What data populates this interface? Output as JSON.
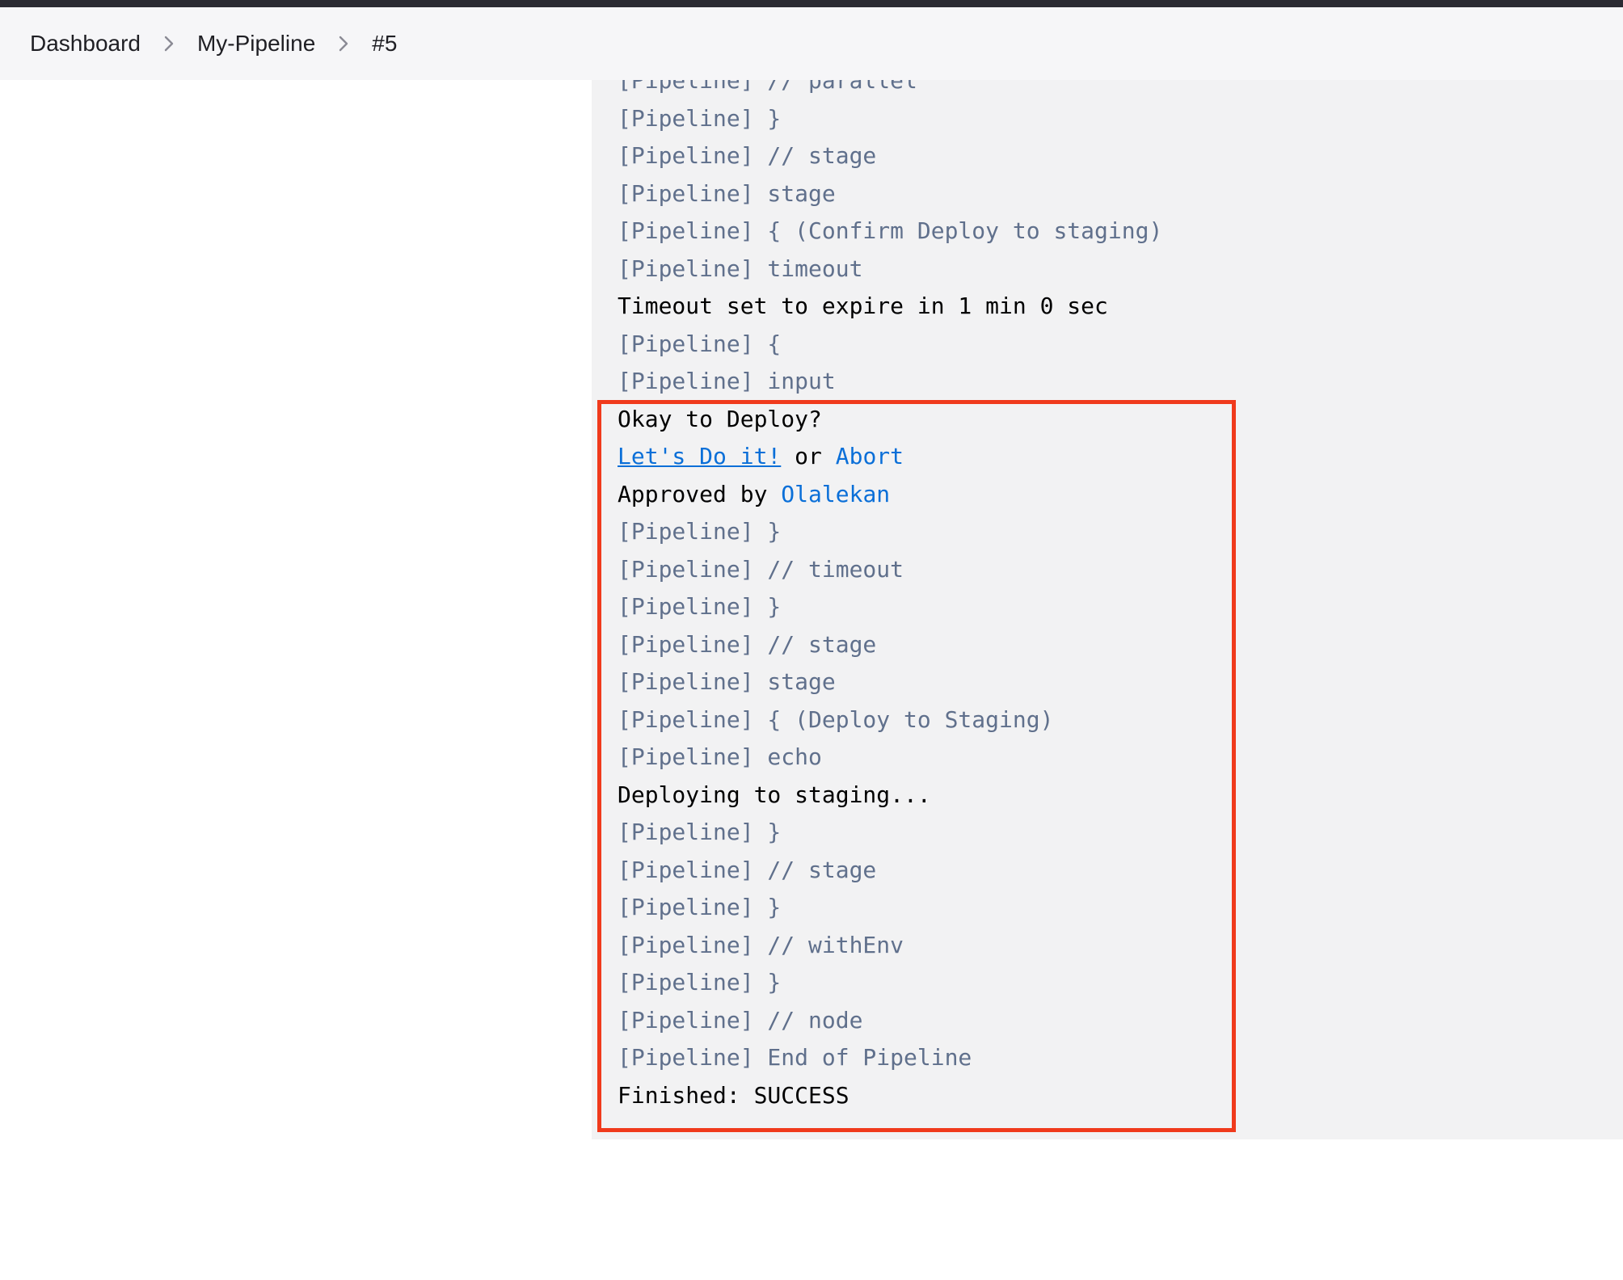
{
  "breadcrumb": {
    "items": [
      {
        "label": "Dashboard"
      },
      {
        "label": "My-Pipeline"
      },
      {
        "label": "#5"
      }
    ],
    "separator_icon": "chevron-right-icon"
  },
  "console": {
    "lines": [
      "[Pipeline] // parallel",
      "[Pipeline] }",
      "[Pipeline] // stage",
      "[Pipeline] stage",
      "[Pipeline] { (Confirm Deploy to staging)",
      "[Pipeline] timeout",
      "Timeout set to expire in 1 min 0 sec",
      "[Pipeline] {",
      "[Pipeline] input",
      "Okay to Deploy?",
      "__INPUT__",
      "__APPROVED__",
      "[Pipeline] }",
      "[Pipeline] // timeout",
      "[Pipeline] }",
      "[Pipeline] // stage",
      "[Pipeline] stage",
      "[Pipeline] { (Deploy to Staging)",
      "[Pipeline] echo",
      "Deploying to staging...",
      "[Pipeline] }",
      "[Pipeline] // stage",
      "[Pipeline] }",
      "[Pipeline] // withEnv",
      "[Pipeline] }",
      "[Pipeline] // node",
      "[Pipeline] End of Pipeline",
      "Finished: SUCCESS"
    ],
    "input": {
      "proceed_label": "Let's Do it!",
      "or_text": " or ",
      "abort_label": "Abort"
    },
    "approved": {
      "prefix": "Approved by ",
      "user": "Olalekan"
    }
  },
  "colors": {
    "pipeline_text": "#60708c",
    "link": "#0a6fd8",
    "highlight_border": "#f03a1c"
  }
}
